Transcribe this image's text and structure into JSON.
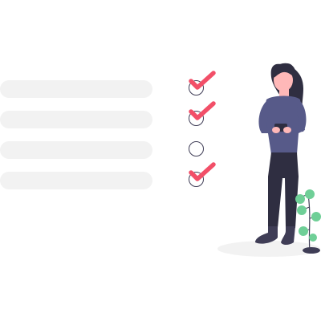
{
  "checklist": {
    "items": [
      {
        "checked": true
      },
      {
        "checked": true
      },
      {
        "checked": false
      },
      {
        "checked": true
      }
    ]
  },
  "colors": {
    "bar": "#f2f2f2",
    "outline": "#3f3d56",
    "check": "#f24f68",
    "shirt": "#575a89",
    "pants": "#2f2e41",
    "hair": "#2f2e41",
    "skin": "#ffb8b8",
    "leaf": "#6fcf97",
    "ground": "#f2f2f2"
  },
  "icons": {
    "check": "check-icon",
    "checkbox": "checkbox-icon",
    "plant": "plant-icon",
    "person": "person-illustration"
  }
}
